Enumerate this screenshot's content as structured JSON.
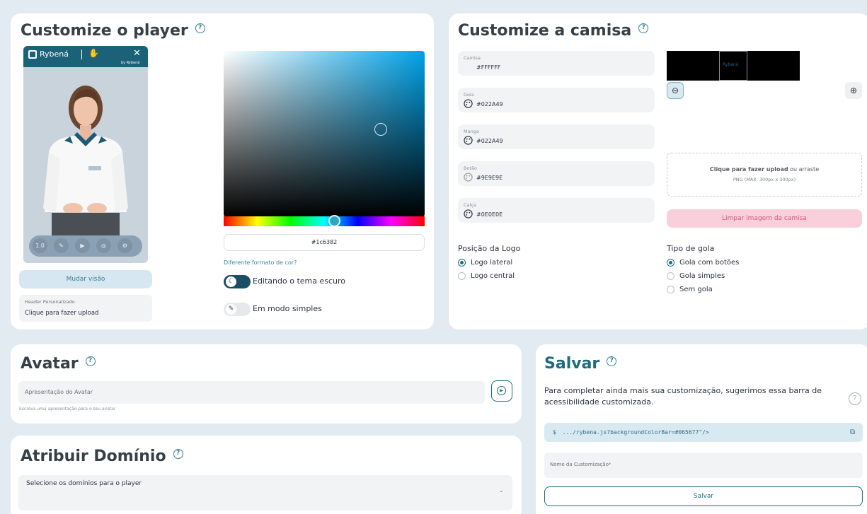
{
  "player": {
    "title": "Customize o player",
    "brand": "Rybená",
    "brand_small": "by Rybená",
    "speed_label": "1.0",
    "change_view_button": "Mudar visão",
    "header_label": "Header Personalizado",
    "header_upload": "Clique para fazer upload",
    "hex_value": "#1c6382",
    "color_format_link": "Diferente formato de cor?",
    "dark_theme_label": "Editando o tema escuro",
    "simple_mode_label": "Em modo simples"
  },
  "shirt": {
    "title": "Customize a camisa",
    "fields": [
      {
        "label": "Camisa",
        "value": "#FFFFFF"
      },
      {
        "label": "Gola",
        "value": "#022A49"
      },
      {
        "label": "Manga",
        "value": "#022A49"
      },
      {
        "label": "Botão",
        "value": "#9E9E9E"
      },
      {
        "label": "Calça",
        "value": "#0E0E0E"
      }
    ],
    "preview_logo": "Rybená",
    "upload_strong": "Clique para fazer upload",
    "upload_rest": " ou arraste",
    "upload_hint": "PNG (MAX. 300px x 300px)",
    "clear_button": "Limpar imagem da camisa",
    "logo_position_title": "Posição da Logo",
    "logo_position_options": [
      {
        "label": "Logo lateral",
        "selected": true
      },
      {
        "label": "Logo central",
        "selected": false
      }
    ],
    "collar_title": "Tipo de gola",
    "collar_options": [
      {
        "label": "Gola com botões",
        "selected": true
      },
      {
        "label": "Gola simples",
        "selected": false
      },
      {
        "label": "Sem gola",
        "selected": false
      }
    ]
  },
  "avatar": {
    "title": "Avatar",
    "input_label": "Apresentação do Avatar",
    "hint": "Escreva uma apresentação para o seu avatar"
  },
  "domain": {
    "title": "Atribuir Domínio",
    "select_placeholder": "Selecione os domínios para o player"
  },
  "save": {
    "title": "Salvar",
    "description": "Para completar ainda mais sua customização, sugerimos essa barra de acessibilidade customizada.",
    "code_prompt": "$",
    "code": ".../rybena.js?backgroundColorBar=#065677\"/>",
    "name_label": "Nome da Customização",
    "required_mark": "*",
    "save_button": "Salvar"
  },
  "colors": {
    "accent": "#1e6a80",
    "picker_hue": "#00a2e8",
    "clear_button_bg": "#f9cfdc",
    "code_bg": "#d8e9f2",
    "mudar_bg": "#d6e7f1"
  }
}
